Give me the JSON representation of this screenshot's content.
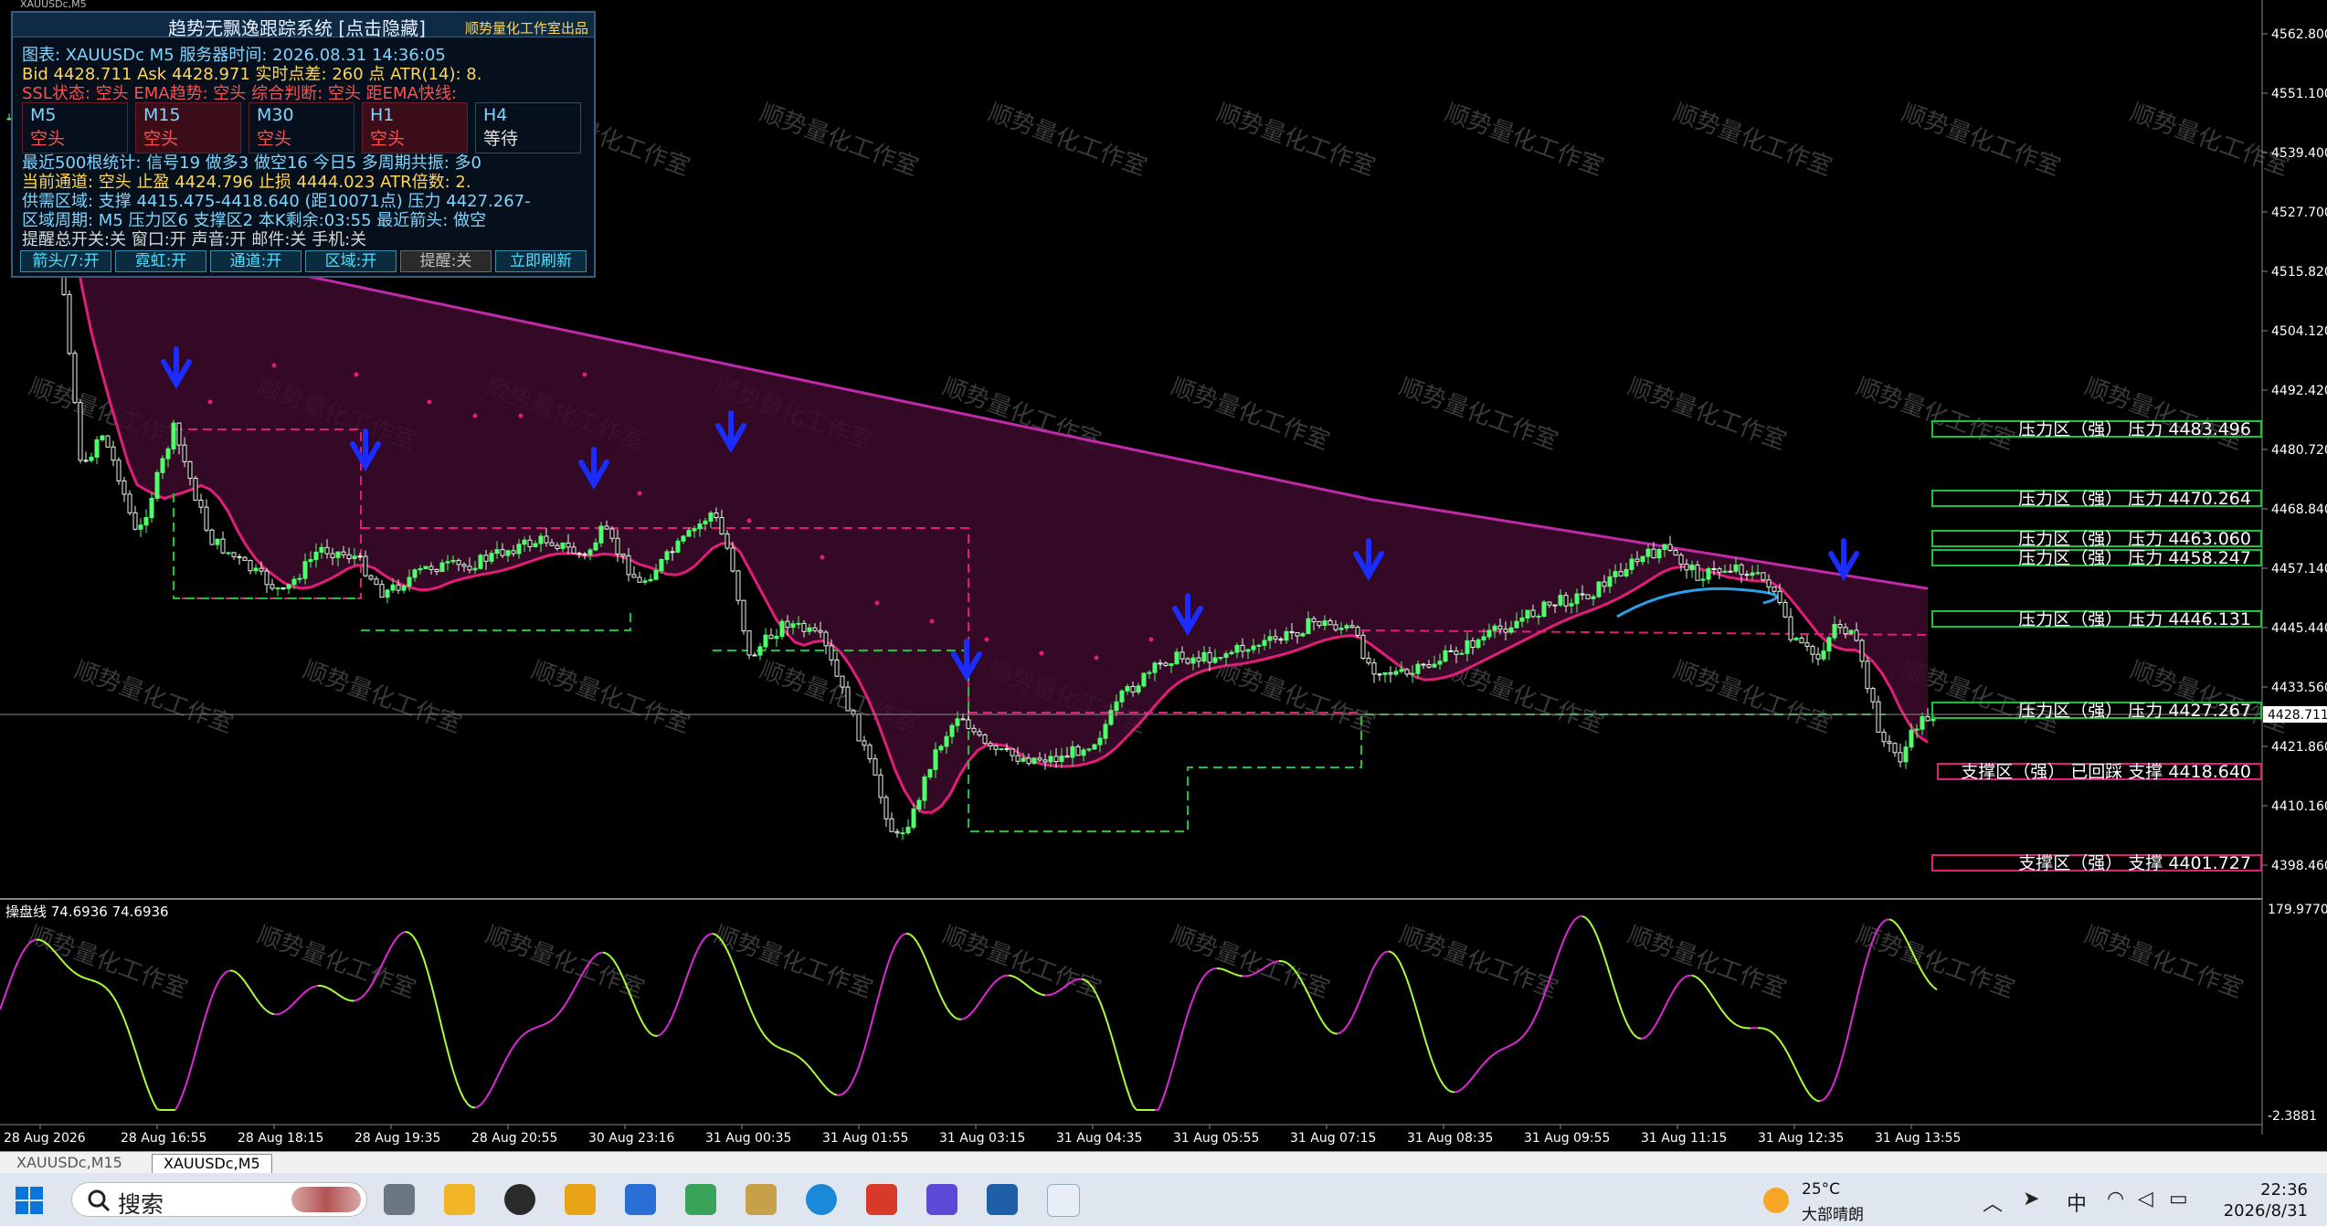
{
  "window": {
    "caption": "XAUUSDc,M5"
  },
  "panel": {
    "title": "趋势无飘逸跟踪系统    [点击隐藏]",
    "subtitle": "顺势量化工作室出品",
    "line1": "图表: XAUUSDc  M5    服务器时间: 2026.08.31 14:36:05",
    "line2": "Bid 4428.711    Ask 4428.971    实时点差: 260 点    ATR(14): 8.",
    "line3": "SSL状态: 空头    EMA趋势: 空头    综合判断: 空头    距EMA快线:",
    "timeframes": [
      {
        "name": "M5",
        "state": "空头"
      },
      {
        "name": "M15",
        "state": "空头"
      },
      {
        "name": "M30",
        "state": "空头"
      },
      {
        "name": "H1",
        "state": "空头"
      },
      {
        "name": "H4",
        "state": "等待"
      }
    ],
    "line4": "最近500根统计: 信号19  做多3  做空16  今日5    多周期共振: 多0",
    "line5": "当前通道: 空头    止盈 4424.796    止损 4444.023    ATR倍数: 2.",
    "line6": "供需区域: 支撑 4415.475-4418.640 (距10071点)      压力 4427.267-",
    "line7": "区域周期: M5  压力区6  支撑区2  本K剩余:03:55    最近箭头: 做空",
    "line8": "提醒总开关:关  窗口:开  声音:开  邮件:关  手机:关",
    "buttons": [
      "箭头/7:开",
      "霓虹:开",
      "通道:开",
      "区域:开",
      "提醒:关",
      "立即刷新"
    ]
  },
  "colors": {
    "bull": "#4dff6a",
    "bear": "#e8f8e8",
    "resistance": "#19c33b",
    "support": "#e0207a",
    "arrow": "#1a2cff"
  },
  "price_axis": [
    "4562.800",
    "4551.100",
    "4539.400",
    "4527.700",
    "4515.820",
    "4504.120",
    "4492.420",
    "4480.720",
    "4468.840",
    "4457.140",
    "4445.440",
    "4433.560",
    "4421.860",
    "4410.160",
    "4398.460"
  ],
  "current_price": "4428.711",
  "levels": [
    {
      "zone": "压力区（强）",
      "label": "压力 4483.496",
      "type": "res"
    },
    {
      "zone": "压力区（强）",
      "label": "压力 4470.264",
      "type": "res"
    },
    {
      "zone": "压力区（强）",
      "label": "压力 4463.060",
      "type": "res"
    },
    {
      "zone": "压力区（强）",
      "label": "压力 4458.247",
      "type": "res"
    },
    {
      "zone": "压力区（强）",
      "label": "压力 4446.131",
      "type": "res"
    },
    {
      "zone": "压力区（强）",
      "label": "压力 4427.267",
      "type": "res"
    },
    {
      "zone": "支撑区（强）  已回踩",
      "label": "支撑 4418.640",
      "type": "sup"
    },
    {
      "zone": "支撑区（强）",
      "label": "支撑 4401.727",
      "type": "sup"
    }
  ],
  "oscillator": {
    "label": "操盘线 74.6936 74.6936",
    "top": "179.9770",
    "bottom": "-2.3881"
  },
  "time_axis": [
    "28 Aug 2026",
    "28 Aug 16:55",
    "28 Aug 18:15",
    "28 Aug 19:35",
    "28 Aug 20:55",
    "30 Aug 23:16",
    "31 Aug 00:35",
    "31 Aug 01:55",
    "31 Aug 03:15",
    "31 Aug 04:35",
    "31 Aug 05:55",
    "31 Aug 07:15",
    "31 Aug 08:35",
    "31 Aug 09:55",
    "31 Aug 11:15",
    "31 Aug 12:35",
    "31 Aug 13:55"
  ],
  "watermark": "顺势量化工作室",
  "tabs": [
    "XAUUSDc,M15",
    "XAUUSDc,M5"
  ],
  "taskbar": {
    "search_label": "搜索",
    "weather_temp": "25°C",
    "weather_desc": "大部晴朗",
    "ime": "中",
    "time": "22:36",
    "date": "2026/8/31"
  }
}
